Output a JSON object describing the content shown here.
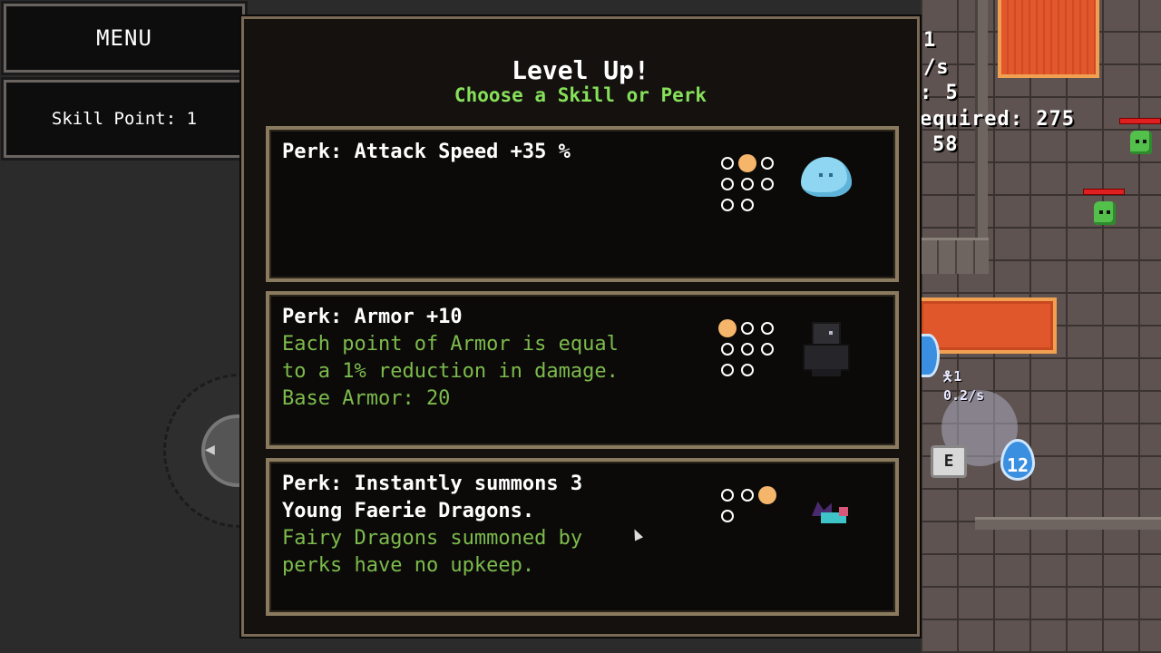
{
  "hud": {
    "line1": "1",
    "line2": "/s",
    "line3": ": 5",
    "line4": "equired: 275",
    "line5": "58",
    "buff_count": "1",
    "regen_rate": "0.2/s",
    "interact_key": "E",
    "mana_value": "12"
  },
  "sidebar": {
    "menu_label": "MENU",
    "skill_points": "Skill Point: 1"
  },
  "dialog": {
    "title": "Level Up!",
    "subtitle": "Choose a Skill or Perk",
    "cards": [
      {
        "title": "Perk: Attack Speed +35 %",
        "desc_lines": [],
        "icon": "slime-icon",
        "dots_total": 8,
        "dot_filled_index": 1
      },
      {
        "title": "Perk: Armor +10",
        "desc_lines": [
          "Each point of Armor is equal",
          "to a 1% reduction in damage.",
          "Base Armor: 20"
        ],
        "icon": "armor-icon",
        "dots_total": 8,
        "dot_filled_index": 0
      },
      {
        "title_lines": [
          "Perk: Instantly summons 3",
          "Young Faerie Dragons."
        ],
        "desc_lines": [
          "Fairy Dragons summoned by",
          "perks have no upkeep."
        ],
        "icon": "faerie-dragon-icon",
        "dots_total": 4,
        "dot_filled_index": 2
      }
    ]
  },
  "colors": {
    "title": "#ffffff",
    "subtitle": "#86e05a",
    "description": "#7dbb4c",
    "dot_filled": "#f5b56a",
    "dialog_border": "#8a7a5e"
  }
}
